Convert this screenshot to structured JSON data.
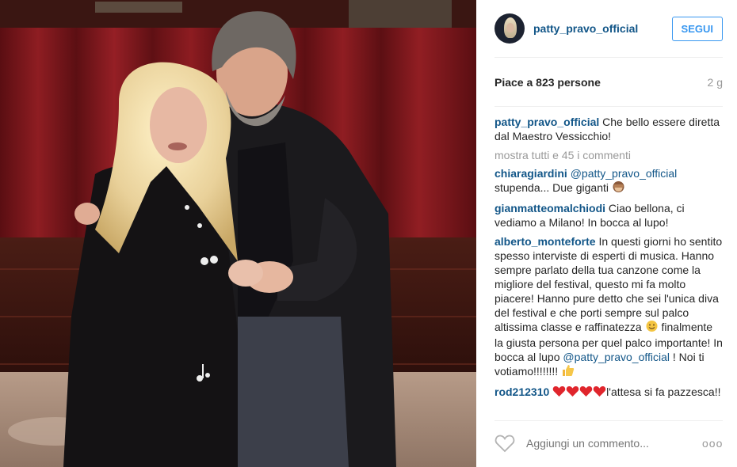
{
  "header": {
    "username": "patty_pravo_official",
    "follow_label": "SEGUI"
  },
  "meta": {
    "likes": "Piace a 823 persone",
    "age": "2 g"
  },
  "caption": {
    "author": "patty_pravo_official",
    "text": " Che bello essere diretta dal Maestro Vessicchio!"
  },
  "show_all": "mostra tutti e 45 i commenti",
  "comments": [
    {
      "author": "chiaragiardini",
      "mention": "@patty_pravo_official",
      "text": " stupenda... Due giganti",
      "emoji": "see-no-evil-monkey"
    },
    {
      "author": "gianmatteomalchiodi",
      "text": " Ciao bellona, ci vediamo a Milano! In bocca al lupo!"
    },
    {
      "author": "alberto_monteforte",
      "text_before": " In questi giorni ho sentito spesso interviste di esperti di musica. Hanno sempre parlato della tua canzone come la migliore del festival, questo mi fa molto piacere! Hanno pure detto che sei l'unica diva del festival e che porti sempre sul palco altissima classe e raffinatezza ",
      "text_mid": " finalmente la giusta persona per quel palco importante! In bocca al lupo ",
      "mention": "@patty_pravo_official",
      "text_after": " ! Noi ti votiamo!!!!!!!! "
    },
    {
      "author": "rod212310",
      "text": "l'attesa si fa pazzesca!!",
      "emoji": "red-heart x4"
    }
  ],
  "footer": {
    "add_comment_placeholder": "Aggiungi un commento...",
    "more_label": "ooo"
  },
  "colors": {
    "link": "#125688",
    "follow": "#3897f0",
    "muted": "#999999",
    "text": "#262626"
  }
}
